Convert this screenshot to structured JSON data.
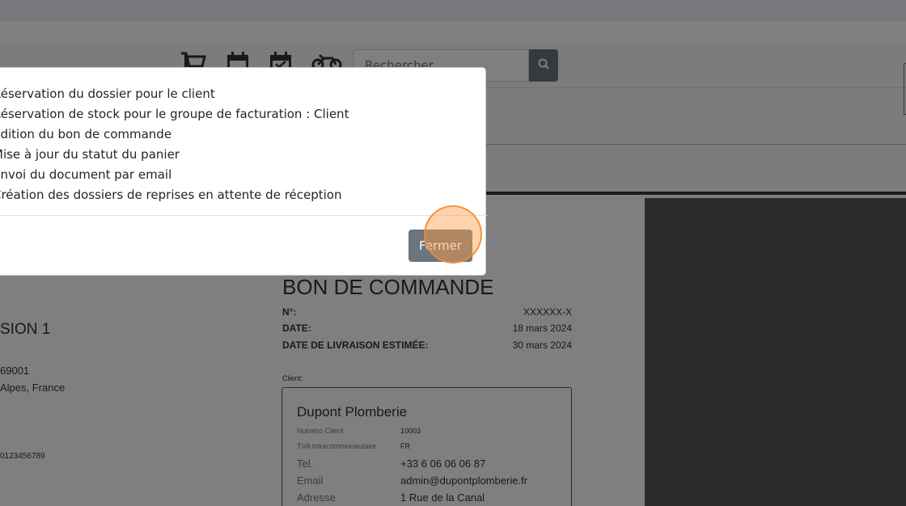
{
  "navbar": {
    "icons": [
      "cart-icon",
      "calendar-icon",
      "calendar-check-icon",
      "motorcycle-icon"
    ],
    "search": {
      "placeholder": "Rechercher"
    }
  },
  "document": {
    "title": "BON DE COMMANDE",
    "left_heading_fragment": "SION 1",
    "left_address_line1": "69001",
    "left_address_line2": "Alpes, France",
    "left_phone": "0123456789",
    "number_label": "N°:",
    "number_value": "XXXXXX-X",
    "date_label": "DATE:",
    "date_value": "18 mars 2024",
    "delivery_label": "DATE DE LIVRAISON ESTIMÉE:",
    "delivery_value": "30 mars 2024",
    "client_label": "Client:",
    "client": {
      "name": "Dupont Plomberie",
      "client_number_label": "Numéro Client",
      "client_number": "10003",
      "vat_label": "TVA intracommunautaire",
      "vat_value": "FR",
      "tel_label": "Tel.",
      "tel_value": "+33 6 06 06 06 87",
      "email_label": "Email",
      "email_value": "admin@dupontplomberie.fr",
      "address_label": "Adresse",
      "address_value": "1 Rue de la Canal"
    }
  },
  "modal": {
    "steps": [
      "Réservation du dossier pour le client",
      "Réservation de stock pour le groupe de facturation : Client",
      "Édition du bon de commande",
      "Mise à jour du statut du panier",
      "Envoi du document par email",
      "Création des dossiers de reprises en attente de réception"
    ],
    "close_label": "Fermer"
  }
}
